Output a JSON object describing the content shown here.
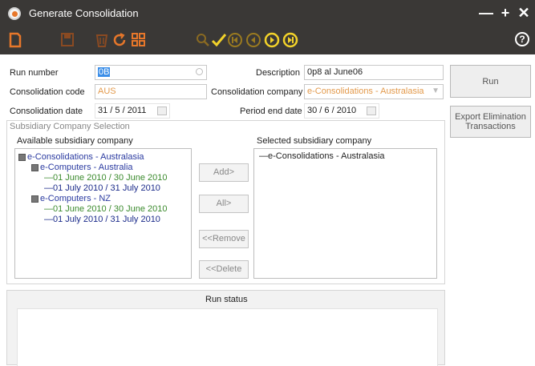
{
  "window": {
    "title": "Generate Consolidation",
    "controls": [
      "—",
      "+",
      "✕"
    ],
    "help": "?"
  },
  "form": {
    "run_number_label": "Run number",
    "run_number_value": "0B",
    "consolidation_code_label": "Consolidation code",
    "consolidation_code_value": "AUS",
    "consolidation_date_label": "Consolidation date",
    "consolidation_date_value": "31 / 5 / 2011",
    "description_label": "Description",
    "description_value": "0p8 al June06",
    "consolidation_company_label": "Consolidation company",
    "consolidation_company_value": "e-Consolidations - Australasia",
    "period_end_label": "Period end date",
    "period_end_value": "30 / 6 / 2010"
  },
  "buttons": {
    "run": "Run",
    "export_line1": "Export Elimination",
    "export_line2": "Transactions",
    "add": "Add>",
    "all": "All>",
    "remove": "<<Remove",
    "delete": "<<Delete"
  },
  "subsidiary": {
    "group_label": "Subsidiary Company Selection",
    "available_label": "Available subsidiary company",
    "selected_label": "Selected subsidiary company",
    "available_tree": [
      {
        "text": "e-Consolidations - Australasia",
        "level": 0,
        "color": "blue"
      },
      {
        "text": "e-Computers - Australia",
        "level": 1,
        "color": "blue"
      },
      {
        "text": "01 June 2010 / 30 June 2010",
        "level": 2,
        "color": "green"
      },
      {
        "text": "01 July 2010 / 31 July 2010",
        "level": 2,
        "color": "darkblue"
      },
      {
        "text": "e-Computers - NZ",
        "level": 1,
        "color": "blue"
      },
      {
        "text": "01 June 2010 / 30 June 2010",
        "level": 2,
        "color": "green"
      },
      {
        "text": "01 July 2010 / 31 July 2010",
        "level": 2,
        "color": "darkblue"
      }
    ],
    "selected_items": [
      "e-Consolidations - Australasia"
    ]
  },
  "status": {
    "label": "Run status"
  }
}
